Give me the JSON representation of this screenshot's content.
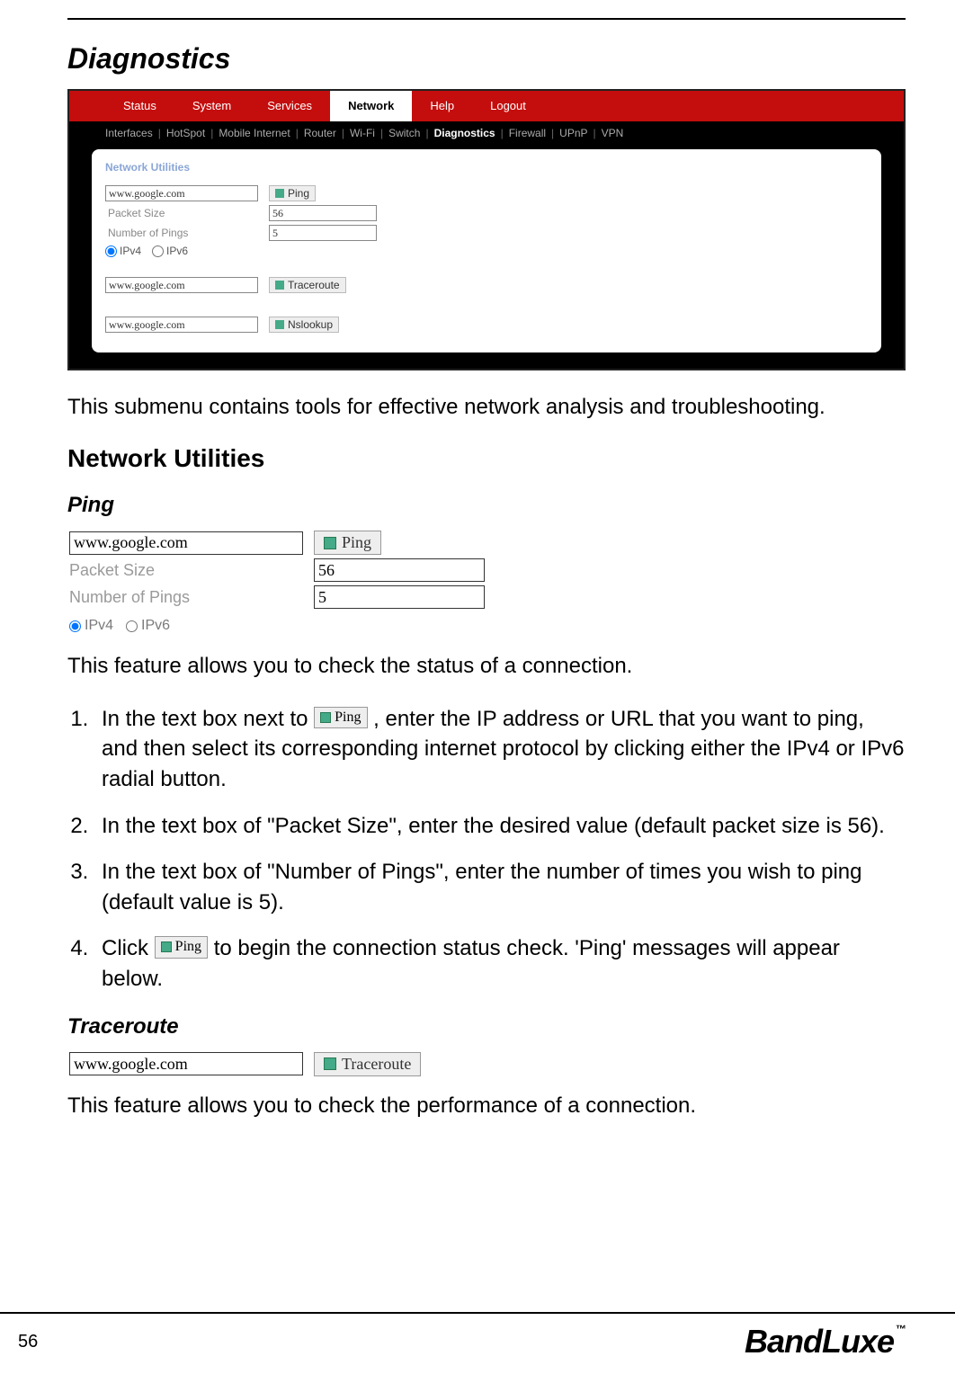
{
  "page": {
    "title": "Diagnostics",
    "number": "56",
    "brand": "BandLuxe",
    "trademark": "™"
  },
  "router": {
    "tabs": [
      "Status",
      "System",
      "Services",
      "Network",
      "Help",
      "Logout"
    ],
    "active_tab": "Network",
    "subtabs": [
      "Interfaces",
      "HotSpot",
      "Mobile Internet",
      "Router",
      "Wi-Fi",
      "Switch",
      "Diagnostics",
      "Firewall",
      "UPnP",
      "VPN"
    ],
    "active_subtab": "Diagnostics",
    "panel_header": "Network Utilities",
    "ping": {
      "host": "www.google.com",
      "button": "Ping",
      "packet_label": "Packet Size",
      "packet_value": "56",
      "numpings_label": "Number of Pings",
      "numpings_value": "5",
      "ipv4": "IPv4",
      "ipv6": "IPv6"
    },
    "traceroute": {
      "host": "www.google.com",
      "button": "Traceroute"
    },
    "nslookup": {
      "host": "www.google.com",
      "button": "Nslookup"
    }
  },
  "intro": "This submenu contains tools for effective network analysis and troubleshooting.",
  "heading_netutils": "Network Utilities",
  "ping_section": {
    "title": "Ping",
    "host": "www.google.com",
    "button": "Ping",
    "packet_label": "Packet Size",
    "packet_value": "56",
    "numpings_label": "Number of Pings",
    "numpings_value": "5",
    "ipv4": "IPv4",
    "ipv6": "IPv6",
    "desc": "This feature allows you to check the status of a connection.",
    "steps": {
      "s1_a": "In the text box next to ",
      "s1_b": ", enter the IP address or URL that you want to ping, and then select its corresponding internet protocol by clicking either the IPv4 or IPv6 radial button.",
      "s2": "In the text box of \"Packet Size\", enter the desired value (default packet size is 56).",
      "s3": "In the text box of \"Number of Pings\", enter the number of times you wish to ping (default value is 5).",
      "s4_a": "Click ",
      "s4_b": " to begin the connection status check. 'Ping' messages will appear below."
    }
  },
  "traceroute_section": {
    "title": "Traceroute",
    "host": "www.google.com",
    "button": "Traceroute",
    "desc": "This feature allows you to check the performance of a connection."
  }
}
